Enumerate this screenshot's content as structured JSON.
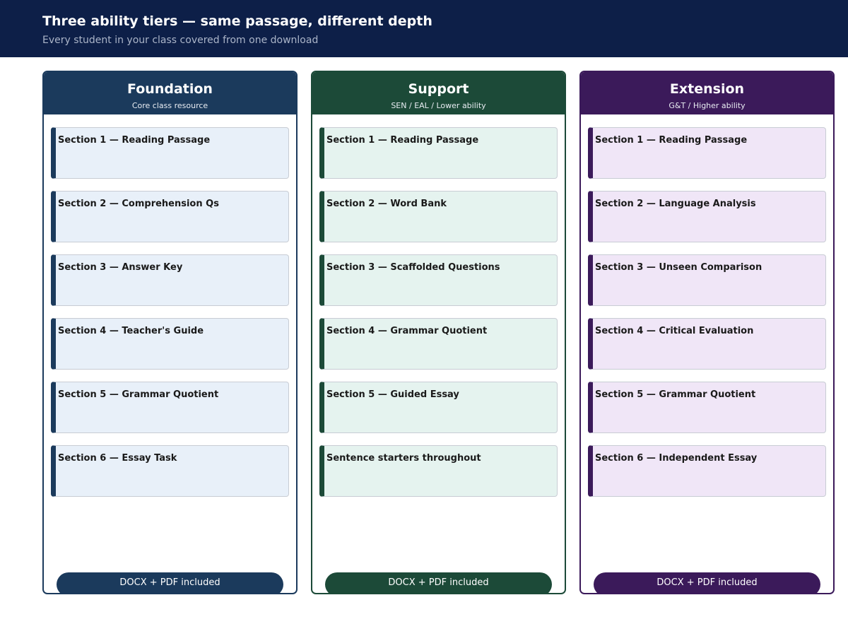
{
  "header": {
    "title": "Three ability tiers — same passage, different depth",
    "subtitle": "Every student in your class covered from one download"
  },
  "tiers": [
    {
      "title": "Foundation",
      "subtitle": "Core class resource",
      "accent": "#1b3a5c",
      "card_bg": "#e8f0f9",
      "sections": [
        "Section 1 — Reading Passage",
        "Section 2 — Comprehension Qs",
        "Section 3 — Answer Key",
        "Section 4 — Teacher's Guide",
        "Section 5 — Grammar Quotient",
        "Section 6 — Essay Task"
      ],
      "footer": "DOCX + PDF included"
    },
    {
      "title": "Support",
      "subtitle": "SEN / EAL / Lower ability",
      "accent": "#1c4a38",
      "card_bg": "#e5f3ef",
      "sections": [
        "Section 1 — Reading Passage",
        "Section 2 — Word Bank",
        "Section 3 — Scaffolded Questions",
        "Section 4 — Grammar Quotient",
        "Section 5 — Guided Essay",
        "Sentence starters throughout"
      ],
      "footer": "DOCX + PDF included"
    },
    {
      "title": "Extension",
      "subtitle": "G&T / Higher ability",
      "accent": "#3b1a5a",
      "card_bg": "#f0e6f7",
      "sections": [
        "Section 1 — Reading Passage",
        "Section 2 — Language Analysis",
        "Section 3 — Unseen Comparison",
        "Section 4 — Critical Evaluation",
        "Section 5 — Grammar Quotient",
        "Section 6 — Independent Essay"
      ],
      "footer": "DOCX + PDF included"
    }
  ]
}
